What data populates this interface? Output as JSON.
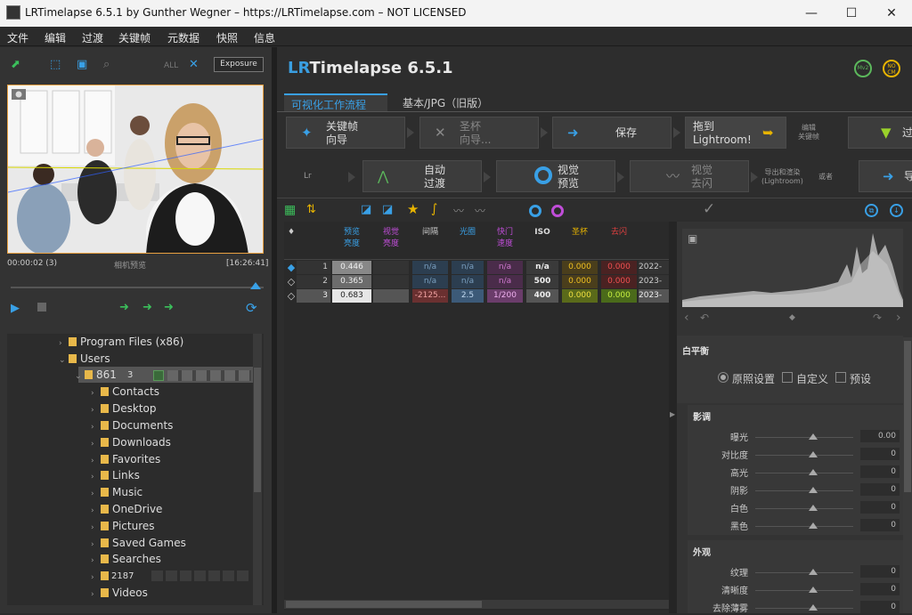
{
  "window": {
    "title": "LRTimelapse 6.5.1 by Gunther Wegner – https://LRTimelapse.com – NOT LICENSED",
    "min": "—",
    "max": "☐",
    "close": "✕"
  },
  "menu": [
    "文件",
    "编辑",
    "过渡",
    "关键帧",
    "元数据",
    "快照",
    "信息"
  ],
  "left": {
    "toolbar": {
      "all": "ALL",
      "exposure_btn": "Exposure"
    },
    "preview": {
      "time_left": "00:00:02 (3)",
      "caption": "相机预览",
      "time_right": "[16:26:41]"
    },
    "tree": {
      "items": [
        {
          "label": "Program Files (x86)",
          "level": 1
        },
        {
          "label": "Users",
          "level": 1,
          "expanded": true
        },
        {
          "label": "861",
          "level": 2,
          "count": "3",
          "selected": true
        },
        {
          "label": "Contacts",
          "level": 3
        },
        {
          "label": "Desktop",
          "level": 3
        },
        {
          "label": "Documents",
          "level": 3
        },
        {
          "label": "Downloads",
          "level": 3
        },
        {
          "label": "Favorites",
          "level": 3
        },
        {
          "label": "Links",
          "level": 3
        },
        {
          "label": "Music",
          "level": 3
        },
        {
          "label": "OneDrive",
          "level": 3
        },
        {
          "label": "Pictures",
          "level": 3
        },
        {
          "label": "Saved Games",
          "level": 3
        },
        {
          "label": "Searches",
          "level": 3
        },
        {
          "label": "",
          "level": 3,
          "count": "2187"
        },
        {
          "label": "Videos",
          "level": 3
        }
      ]
    }
  },
  "app": {
    "logo_lr": "LR",
    "logo_rest": "Timelapse 6.5.1",
    "badges": [
      "Mv2",
      "NO CM"
    ],
    "tabs": {
      "visual": "可视化工作流程",
      "basic": "基本/JPG（旧版）"
    },
    "row1": [
      {
        "label": "关键帧\n向导",
        "icon": "magic-wand-icon",
        "dim": false
      },
      {
        "label": "圣杯\n向导...",
        "icon": "holy-grail-icon",
        "dim": true
      },
      {
        "label": "保存",
        "icon": "save-icon",
        "dim": false
      },
      {
        "label": "拖到\nLightroom!",
        "icon": "lightroom-arrow-icon",
        "dim": false
      },
      {
        "label": "过",
        "icon": "filter-icon",
        "dim": false
      }
    ],
    "row1_small": "编辑\n关键帧",
    "row2": [
      {
        "label": "自动\n过渡",
        "icon": "curve-icon",
        "dim": false
      },
      {
        "label": "视觉\n预览",
        "icon": "ring-icon",
        "dim": false
      },
      {
        "label": "视觉\n去闪",
        "icon": "flicker-icon",
        "dim": true
      },
      {
        "label": "导",
        "icon": "export-icon",
        "dim": false
      }
    ],
    "row2_small_lr": "Lr",
    "row2_small_export": "导出和渲染\n(Lightroom)",
    "row2_small_or": "或者"
  },
  "table": {
    "headers": [
      "♦",
      "预览\n亮度",
      "视觉\n亮度",
      "间隔",
      "光圈",
      "快门\n速度",
      "ISO",
      "圣杯",
      "去闪"
    ],
    "rows": [
      {
        "n": "1",
        "prev": "0.446",
        "interval": "n/a",
        "aperture": "n/a",
        "shutter": "n/a",
        "iso": "n/a",
        "hg": "0.000",
        "deflicker": "0.000",
        "date": "2022-"
      },
      {
        "n": "2",
        "prev": "0.365",
        "interval": "n/a",
        "aperture": "n/a",
        "shutter": "n/a",
        "iso": "500",
        "hg": "0.000",
        "deflicker": "0.000",
        "date": "2023-"
      },
      {
        "n": "3",
        "prev": "0.683",
        "interval": "-2125...",
        "aperture": "2.5",
        "shutter": "1/200",
        "iso": "400",
        "hg": "0.000",
        "deflicker": "0.000",
        "date": "2023-"
      }
    ]
  },
  "panel": {
    "wb_title": "白平衡",
    "wb_options": [
      "原照设置",
      "自定义",
      "预设"
    ],
    "tone_title": "影调",
    "tone": [
      {
        "label": "曝光",
        "value": "0.00"
      },
      {
        "label": "对比度",
        "value": "0"
      },
      {
        "label": "高光",
        "value": "0"
      },
      {
        "label": "阴影",
        "value": "0"
      },
      {
        "label": "白色",
        "value": "0"
      },
      {
        "label": "黑色",
        "value": "0"
      }
    ],
    "presence_title": "外观",
    "presence": [
      {
        "label": "纹理",
        "value": "0"
      },
      {
        "label": "清晰度",
        "value": "0"
      },
      {
        "label": "去除薄雾",
        "value": "0"
      }
    ]
  }
}
